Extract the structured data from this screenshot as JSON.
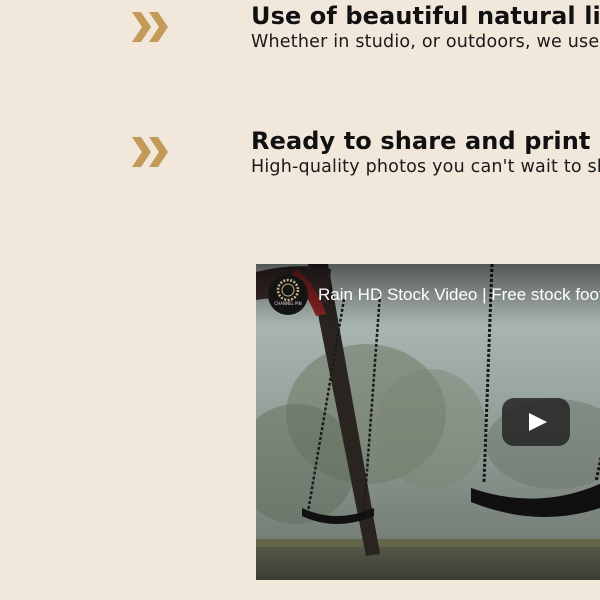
{
  "features": [
    {
      "icon": "double-chevron-right-icon",
      "title": "Use of beautiful natural light",
      "description": "Whether in studio, or outdoors, we use"
    },
    {
      "icon": "double-chevron-right-icon",
      "title": "Ready to share and print images",
      "description": "High-quality photos you can't wait to share"
    }
  ],
  "video": {
    "title": "Rain HD Stock Video | Free stock footage",
    "channel": {
      "name": "CHANNEL PIN",
      "avatar_icon": "channel-logo-icon"
    },
    "play_icon": "play-icon"
  },
  "colors": {
    "background": "#f1e7db",
    "accent": "#c49a58",
    "text": "#111111",
    "play_button": "#212121"
  }
}
